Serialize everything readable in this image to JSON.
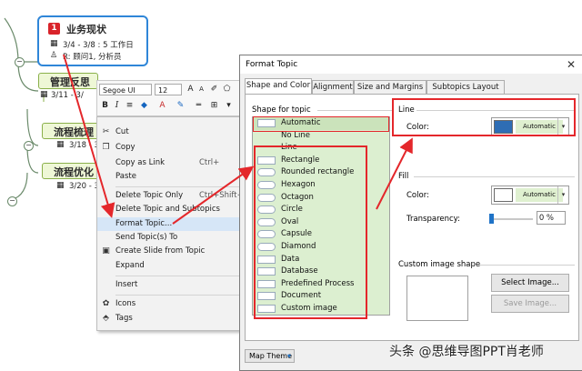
{
  "mindmap": {
    "topics": [
      {
        "title": "业务现状",
        "badge": "1",
        "details": [
          "3/4 - 3/8 : 5 工作日",
          "R: 顾问1, 分析员"
        ]
      },
      {
        "title": "管理反思",
        "details": [
          "3/11 - 3/"
        ]
      },
      {
        "title": "流程梳理",
        "details": [
          "3/18 - 3/"
        ]
      },
      {
        "title": "流程优化",
        "details": [
          "3/20 - 3/"
        ]
      }
    ],
    "collapse_symbol": "−"
  },
  "mini_toolbar": {
    "font_name": "Segoe UI",
    "font_size": "12"
  },
  "context_menu": {
    "items": [
      {
        "label": "Cut",
        "icon": "scissors-icon",
        "glyph": "✂"
      },
      {
        "label": "Copy",
        "icon": "copy-icon",
        "glyph": "❐"
      },
      {
        "label": "Copy as Link",
        "shortcut": "Ctrl+"
      },
      {
        "label": "Paste"
      },
      {
        "label": "Delete Topic Only",
        "shortcut": "Ctrl+Shift+D"
      },
      {
        "label": "Delete Topic and Subtopics"
      },
      {
        "label": "Format Topic..."
      },
      {
        "label": "Send Topic(s) To"
      },
      {
        "label": "Create Slide from Topic",
        "icon": "slide-icon",
        "glyph": "▣"
      },
      {
        "label": "Expand"
      },
      {
        "label": "Insert"
      },
      {
        "label": "Icons",
        "icon": "icons-icon",
        "glyph": "✿"
      },
      {
        "label": "Tags",
        "icon": "tag-icon",
        "glyph": "⬘"
      }
    ]
  },
  "dialog": {
    "title": "Format Topic",
    "close_glyph": "✕",
    "tabs": [
      "Shape and Color",
      "Alignment",
      "Size and Margins",
      "Subtopics Layout"
    ],
    "shape_section_label": "Shape for topic",
    "shapes": [
      "Automatic",
      "No Line",
      "Line",
      "Rectangle",
      "Rounded rectangle",
      "Hexagon",
      "Octagon",
      "Circle",
      "Oval",
      "Capsule",
      "Diamond",
      "Data",
      "Database",
      "Predefined Process",
      "Document",
      "Custom image"
    ],
    "line": {
      "section_label": "Line",
      "color_label": "Color:",
      "value": "Automatic",
      "swatch_color": "#2e6db4"
    },
    "fill": {
      "section_label": "Fill",
      "color_label": "Color:",
      "value": "Automatic",
      "swatch_color": "#ffffff",
      "transparency_label": "Transparency:",
      "transparency_value": "0 %"
    },
    "custom_image": {
      "section_label": "Custom image shape",
      "select_button": "Select Image...",
      "save_button": "Save Image..."
    },
    "map_theme_button": "Map Theme"
  },
  "colors": {
    "highlight_red": "#e4272b",
    "topic_fill": "#eef7d6",
    "shape_list_fill": "#dcefd0",
    "selection_blue": "#2f86d8"
  },
  "watermark": "头条 @思维导图PPT肖老师"
}
